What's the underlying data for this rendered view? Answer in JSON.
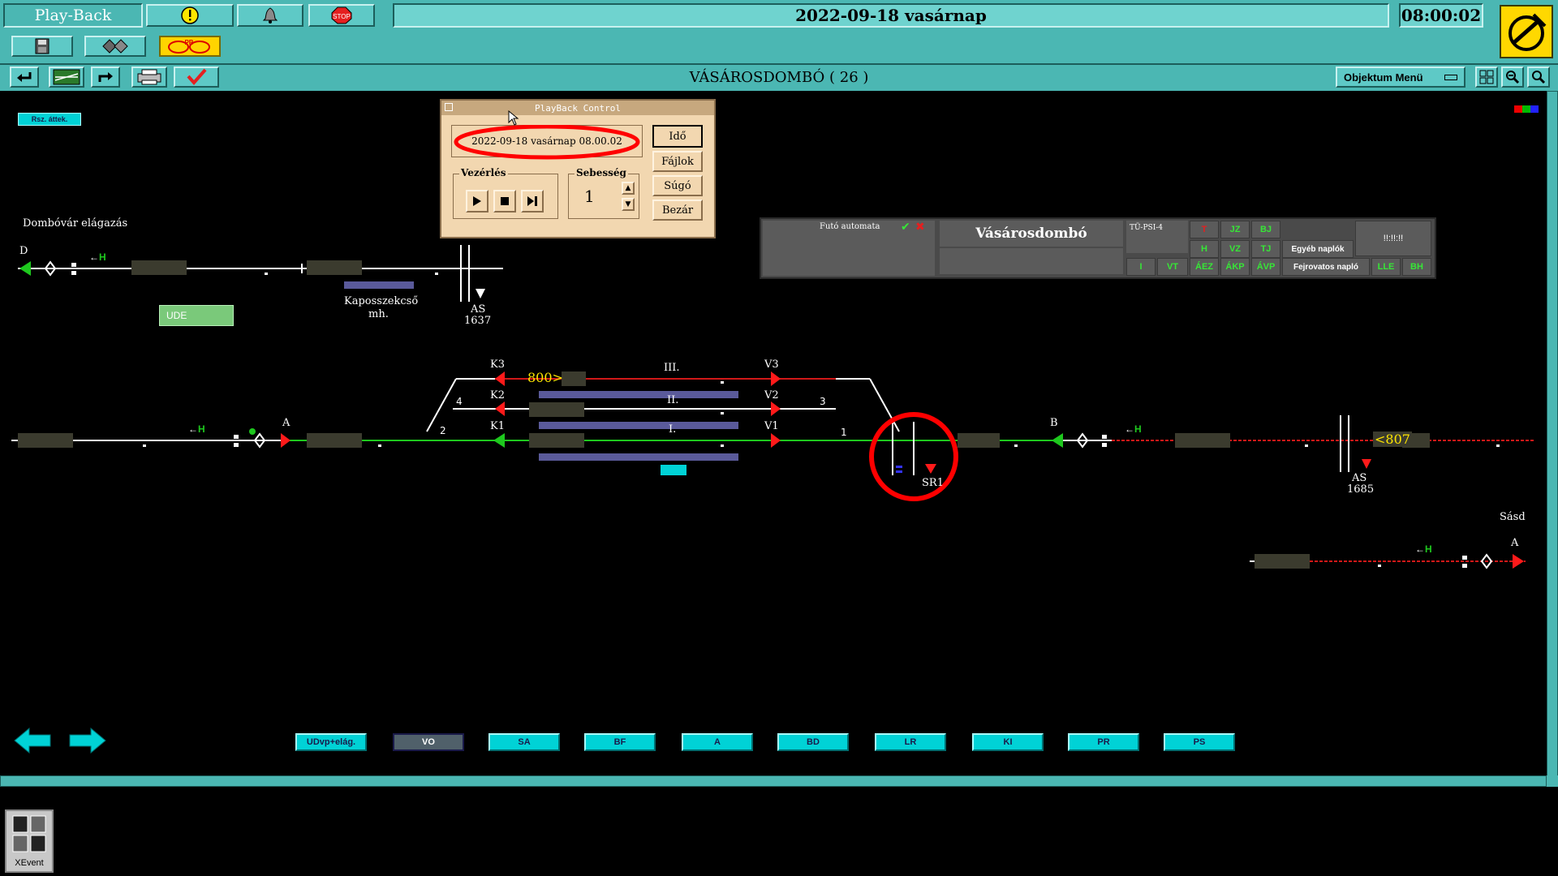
{
  "header": {
    "app_title": "Play-Back",
    "datetime": "2022-09-18  vasárnap",
    "clock": "08:00:02",
    "station_title": "VÁSÁROSDOMBÓ ( 26 )",
    "object_menu": "Objektum Menü",
    "stop_label": "STOP",
    "pb_label": "PB"
  },
  "map": {
    "rsz_button": "Rsz. áttek.",
    "dombovar": "Dombóvár elágazás",
    "ude": "UDE",
    "kaposszekcso": "Kaposszekcső",
    "mh": "mh.",
    "as1637": "AS",
    "as1637_num": "1637",
    "as1685": "AS",
    "as1685_num": "1685",
    "sasd": "Sásd",
    "sr1": "SR1",
    "sig_d": "D",
    "sig_a": "A",
    "sig_b": "B",
    "sig_a_sasd": "A",
    "sig_k1": "K1",
    "sig_k2": "K2",
    "sig_k3": "K3",
    "sig_v1": "V1",
    "sig_v2": "V2",
    "sig_v3": "V3",
    "track_i": "I.",
    "track_ii": "II.",
    "track_iii": "III.",
    "sw1": "1",
    "sw2": "2",
    "sw3": "3",
    "sw4": "4",
    "train_800": "800>",
    "train_807": "<807",
    "h_label": "H"
  },
  "playback": {
    "title": "PlayBack Control",
    "datetime": "2022-09-18 vasárnap 08.00.02",
    "control_label": "Vezérlés",
    "speed_label": "Sebesség",
    "speed_value": "1",
    "btn_time": "Idő",
    "btn_files": "Fájlok",
    "btn_help": "Súgó",
    "btn_close": "Bezár"
  },
  "status_panel": {
    "automata": "Futó automata",
    "station": "Vásárosdombó",
    "tu": "TÜ-PSI-4",
    "t": "T",
    "jz": "JZ",
    "bj": "BJ",
    "h": "H",
    "vz": "VZ",
    "tj": "TJ",
    "i": "I",
    "vt": "VT",
    "aez": "ÁEZ",
    "akp": "ÁKP",
    "avp": "ÁVP",
    "egyeb": "Egyéb naplók",
    "fejrovatos": "Fejrovatos napló",
    "lle": "LLE",
    "bh": "BH",
    "clock": "!!:!!:!!"
  },
  "nav": [
    "UDvp+elág.",
    "VO",
    "SA",
    "BF",
    "A",
    "BD",
    "LR",
    "KI",
    "PR",
    "PS"
  ],
  "taskbar": {
    "xevent": "XEvent"
  },
  "colors": {
    "teal": "#4bb7b3",
    "track_green": "#1ec81e",
    "signal_red": "#ff1a1a",
    "highlight": "#ff0000"
  }
}
